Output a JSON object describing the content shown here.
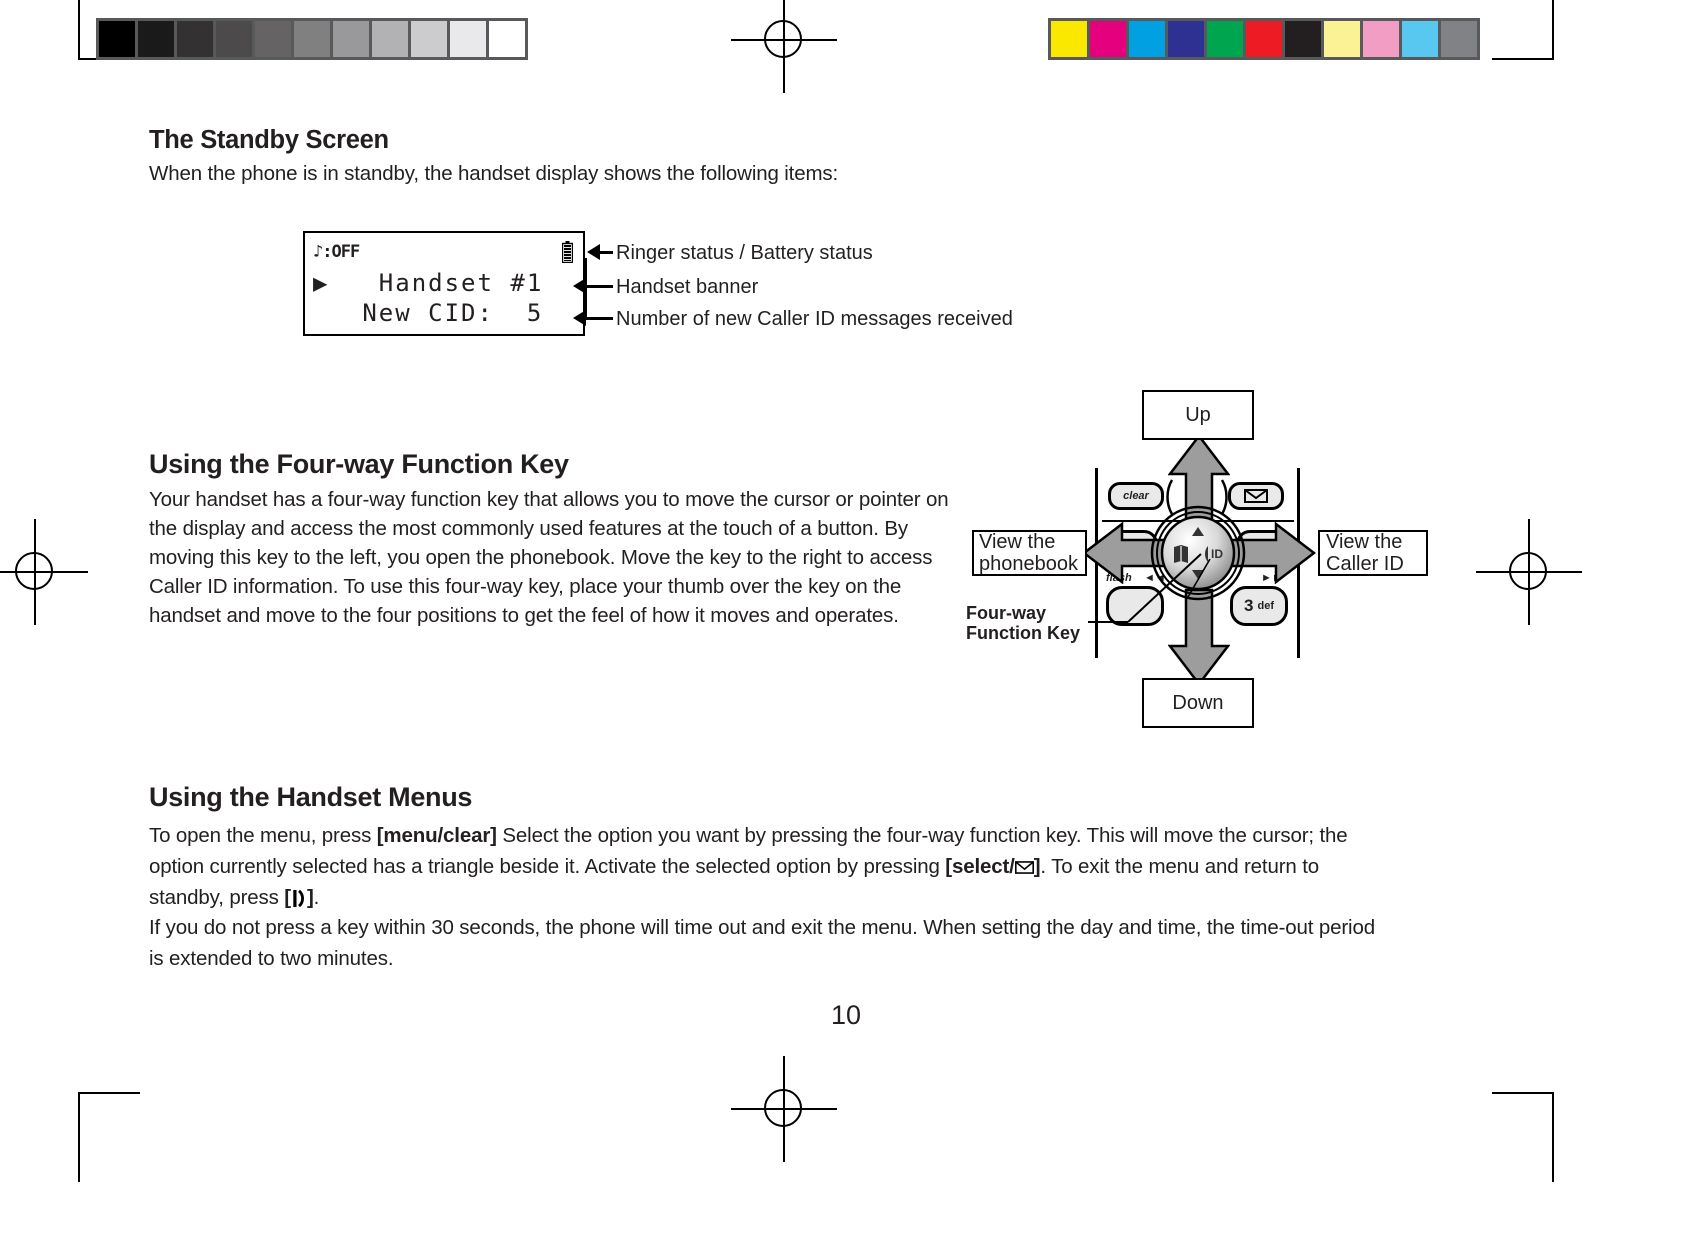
{
  "page": {
    "number": "10"
  },
  "calibration": {
    "gray_bar": {
      "name": "grayscale-calibration-bar",
      "swatches": [
        "#000000",
        "#1b1a1a",
        "#333132",
        "#4c4a4b",
        "#666365",
        "#808080",
        "#99989a",
        "#b2b1b3",
        "#cccbcd",
        "#e9e9eb",
        "#ffffff"
      ],
      "swatch_width": 36
    },
    "color_bar": {
      "name": "color-calibration-bar",
      "swatches": [
        "#fbe800",
        "#e5007e",
        "#00a0e3",
        "#2e3192",
        "#00a54f",
        "#ed1c24",
        "#231f20",
        "#fbf195",
        "#f29ec4",
        "#58c8f0",
        "#808285"
      ],
      "swatch_width": 36
    }
  },
  "sections": {
    "standby": {
      "heading": "The Standby Screen",
      "intro": "When the phone is in standby, the handset display shows the following items:"
    },
    "fourway": {
      "heading": "Using the Four-way Function Key",
      "body": "Your handset has a four-way function key that allows you to move the cursor or pointer on the display and access the most commonly used features at the touch of a button. By moving this key to the left, you open the phonebook. Move the key to the right to access Caller ID information. To use this four-way key, place your thumb over the key on the handset and move to the four positions to get the feel of how it moves and operates."
    },
    "menus": {
      "heading": "Using the Handset Menus",
      "p1_a": "To open the menu, press ",
      "p1_b": "[menu/clear]",
      "p1_c": " Select the option you want by pressing the four-way function key. This will move the cursor; the option currently selected has a triangle beside it. Activate the selected option by pressing ",
      "p1_d": "[select/",
      "p1_e": "]",
      "p1_f": ". To exit the menu and return to standby, press ",
      "p1_g": "[",
      "p1_h": "]",
      "p1_i": ".",
      "p2": "If you do not press a key within 30 seconds, the phone will time out and exit the menu. When setting the day and time, the time-out period is extended to two minutes."
    }
  },
  "lcd": {
    "name": "handset-lcd-display",
    "ringer_status": "♪:OFF",
    "battery_icon": "battery-icon",
    "line1": "▶   Handset #1",
    "line2": "   New CID:  5",
    "callouts": [
      {
        "label": "Ringer status / Battery status"
      },
      {
        "label": "Handset banner"
      },
      {
        "label": "Number of new Caller ID messages received"
      }
    ]
  },
  "keypad": {
    "name": "four-way-function-key-diagram",
    "labels": {
      "up": "Up",
      "down": "Down",
      "left_line1": "View the",
      "left_line2": "phonebook",
      "right_line1": "View the",
      "right_line2": "Caller ID",
      "pointer_line1": "Four-way",
      "pointer_line2": "Function Key"
    },
    "keys": {
      "clear": "clear",
      "message": "envelope-icon",
      "flash": "flash",
      "rewind": "◄◄",
      "forward": "►►",
      "three": "3",
      "three_letters": "def",
      "phonebook_icon": "book-icon",
      "callerid_icon": "ID"
    },
    "arrow_fill": "#9d9d9d"
  }
}
